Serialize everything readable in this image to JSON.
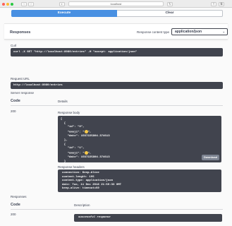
{
  "browser": {
    "address": "localhost"
  },
  "actions": {
    "execute_label": "Execute",
    "clear_label": "Clear"
  },
  "responses_header": {
    "title": "Responses",
    "content_type_label": "Response content type",
    "content_type_value": "application/json"
  },
  "curl": {
    "label": "Curl",
    "command": "curl -X GET \"http://localhost:8080/entries\" -H \"accept: application/json\""
  },
  "request_url": {
    "label": "Request URL",
    "value": "http://localhost:8080/entries"
  },
  "server_response": {
    "label": "Server response",
    "code_header": "Code",
    "details_header": "Details",
    "code": "200",
    "body_label": "Response body",
    "body_lines": {
      "l1": "[",
      "l2": "  {",
      "l3": "    \"id\": \"0\",",
      "l4a": "    \"emoji\": \"",
      "l4b": "\",",
      "l5": "    \"date\": 1567225804.374613",
      "l6": "  },",
      "l7": "  {",
      "l8": "    \"id\": \"1\",",
      "l9a": "    \"emoji\": \"",
      "l9b": "\",",
      "l10": "    \"date\": 1567225804.374613",
      "l11": "  }",
      "l12": "]"
    },
    "download_label": "Download",
    "headers_label": "Response headers",
    "headers_lines": {
      "h1": "connection: Keep-Alive",
      "h2": "content-length: 195",
      "h3": "content-type: application/json",
      "h4": "date: Tue, 11 Dec 2018 21:59:33 GMT",
      "h5": "keep-alive: timeout=60"
    }
  },
  "responses_spec": {
    "label": "Responses",
    "code_header": "Code",
    "description_header": "Description",
    "code": "200",
    "description": "successful response"
  }
}
